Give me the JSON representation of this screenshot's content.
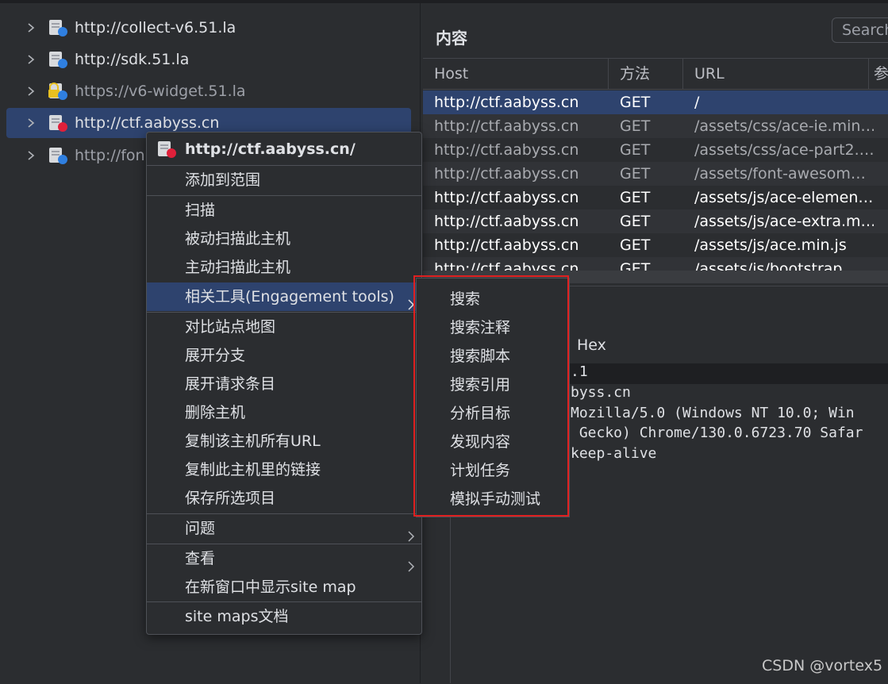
{
  "tree": {
    "items": [
      {
        "label": "http://collect-v6.51.la",
        "secure": false
      },
      {
        "label": "http://sdk.51.la",
        "secure": false
      },
      {
        "label": "https://v6-widget.51.la",
        "secure": true
      },
      {
        "label": "http://ctf.aabyss.cn",
        "secure": false,
        "selected": true
      },
      {
        "label": "http://fon",
        "secure": false
      }
    ]
  },
  "content": {
    "title": "内容",
    "search_placeholder": "Search",
    "columns": [
      "Host",
      "方法",
      "URL",
      "参"
    ],
    "rows": [
      {
        "host": "http://ctf.aabyss.cn",
        "method": "GET",
        "url": "/",
        "selected": true
      },
      {
        "host": "http://ctf.aabyss.cn",
        "method": "GET",
        "url": "/assets/css/ace-ie.min…"
      },
      {
        "host": "http://ctf.aabyss.cn",
        "method": "GET",
        "url": "/assets/css/ace-part2.…"
      },
      {
        "host": "http://ctf.aabyss.cn",
        "method": "GET",
        "url": "/assets/font-awesom…"
      },
      {
        "host": "http://ctf.aabyss.cn",
        "method": "GET",
        "url": "/assets/js/ace-elemen…"
      },
      {
        "host": "http://ctf.aabyss.cn",
        "method": "GET",
        "url": "/assets/js/ace-extra.m…"
      },
      {
        "host": "http://ctf.aabyss.cn",
        "method": "GET",
        "url": "/assets/js/ace.min.js"
      },
      {
        "host": "http://ctf.aabyss.cn",
        "method": "GET",
        "url": "/assets/js/bootstrap…"
      }
    ],
    "hex_tab": "Hex",
    "code_lines": [
      ".1",
      "byss.cn",
      "Mozilla/5.0 (Windows NT 10.0; Win",
      " Gecko) Chrome/130.0.6723.70 Safar",
      "keep-alive"
    ]
  },
  "context_menu": {
    "header": "http://ctf.aabyss.cn/",
    "add_to_scope": "添加到范围",
    "scan": "扫描",
    "passive_scan": "被动扫描此主机",
    "active_scan": "主动扫描此主机",
    "engagement_tools": "相关工具(Engagement tools)",
    "compare_site_maps": "对比站点地图",
    "expand_branch": "展开分支",
    "expand_requested_items": "展开请求条目",
    "delete_host": "删除主机",
    "copy_urls": "复制该主机所有URL",
    "copy_links": "复制此主机里的链接",
    "save_selected": "保存所选项目",
    "issues": "问题",
    "view": "查看",
    "show_new_window": "在新窗口中显示site map",
    "site_map_docs": "site maps文档"
  },
  "submenu": {
    "items": [
      "搜索",
      "搜索注释",
      "搜索脚本",
      "搜索引用",
      "分析目标",
      "发现内容",
      "计划任务",
      "模拟手动测试"
    ],
    "highlight_color": "#e02020"
  },
  "watermark": "CSDN @vortex5"
}
